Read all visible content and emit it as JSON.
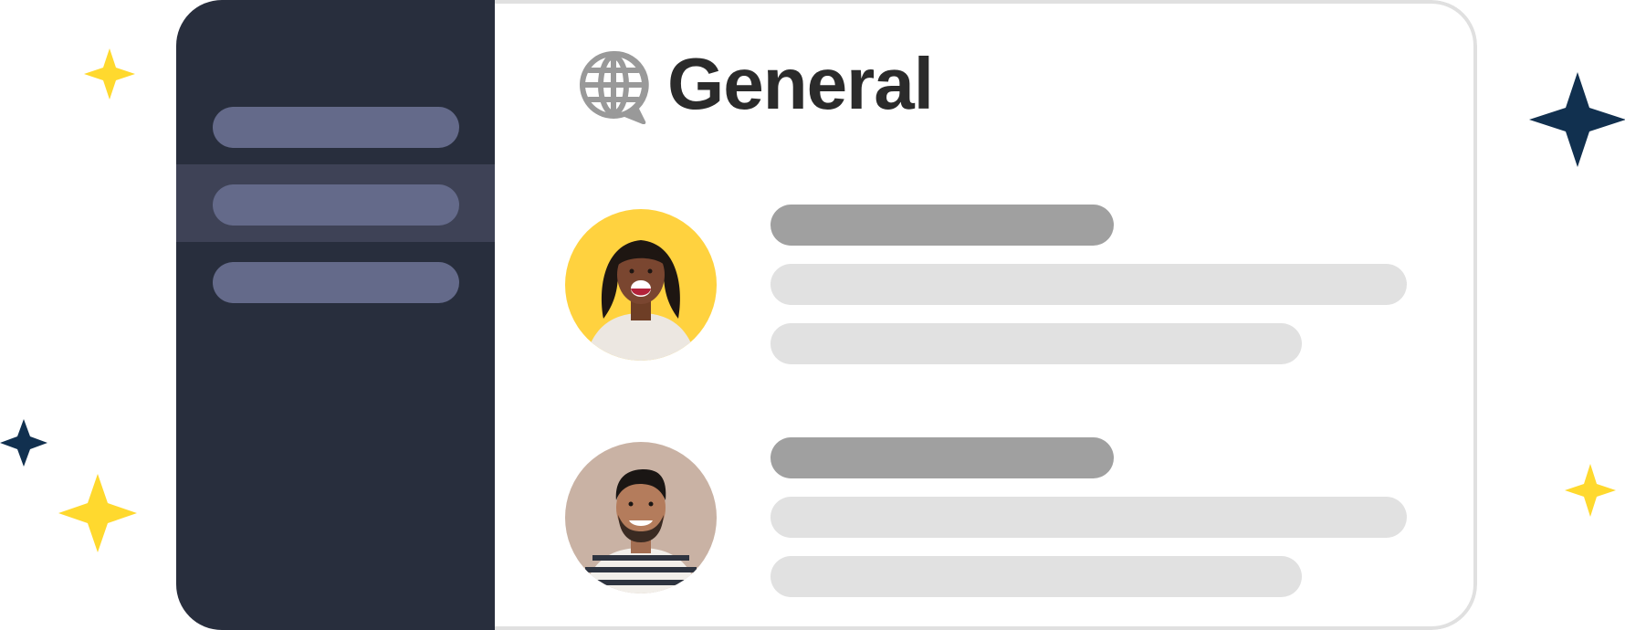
{
  "header": {
    "title": "General",
    "icon": "globe-chat-icon"
  },
  "sidebar": {
    "items": [
      {
        "id": "channel-1",
        "active": false
      },
      {
        "id": "channel-2",
        "active": true
      },
      {
        "id": "channel-3",
        "active": false
      }
    ]
  },
  "messages": [
    {
      "avatar": "woman-avatar",
      "avatar_bg": "#ffd23f"
    },
    {
      "avatar": "man-avatar",
      "avatar_bg": "#c9b2a4"
    }
  ],
  "colors": {
    "sidebar_bg": "#282e3d",
    "sidebar_active": "#3e4256",
    "sidebar_pill": "#646a8a",
    "name_placeholder": "#a0a0a0",
    "text_placeholder": "#e1e1e1",
    "sparkle_yellow": "#ffd92e",
    "sparkle_navy": "#11304f"
  }
}
